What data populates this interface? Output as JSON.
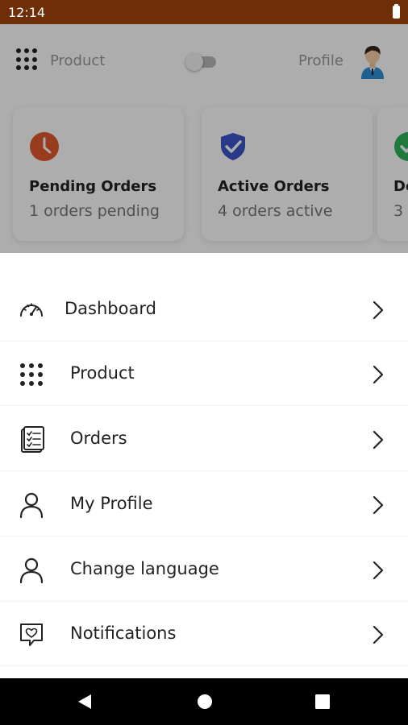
{
  "status_bar": {
    "time": "12:14"
  },
  "header": {
    "product_label": "Product",
    "profile_label": "Profile"
  },
  "cards": [
    {
      "title": "Pending Orders",
      "subtitle": "1 orders pending",
      "icon": "clock-icon",
      "color": "#e0582e"
    },
    {
      "title": "Active Orders",
      "subtitle": "4 orders active",
      "icon": "shield-check-icon",
      "color": "#3a55c8"
    },
    {
      "title": "De",
      "subtitle": "3 o",
      "icon": "check-circle-icon",
      "color": "#2fb35a"
    }
  ],
  "menu": {
    "items": [
      {
        "label": "Dashboard",
        "icon": "speedometer-icon"
      },
      {
        "label": "Product",
        "icon": "grid-dots-icon"
      },
      {
        "label": "Orders",
        "icon": "clipboard-list-icon"
      },
      {
        "label": "My Profile",
        "icon": "person-icon"
      },
      {
        "label": "Change language",
        "icon": "person-icon"
      },
      {
        "label": "Notifications",
        "icon": "chat-heart-icon"
      }
    ]
  },
  "colors": {
    "status_bar": "#6e2e07",
    "overlay": "rgba(0,0,0,0.32)",
    "text": "#222222"
  }
}
